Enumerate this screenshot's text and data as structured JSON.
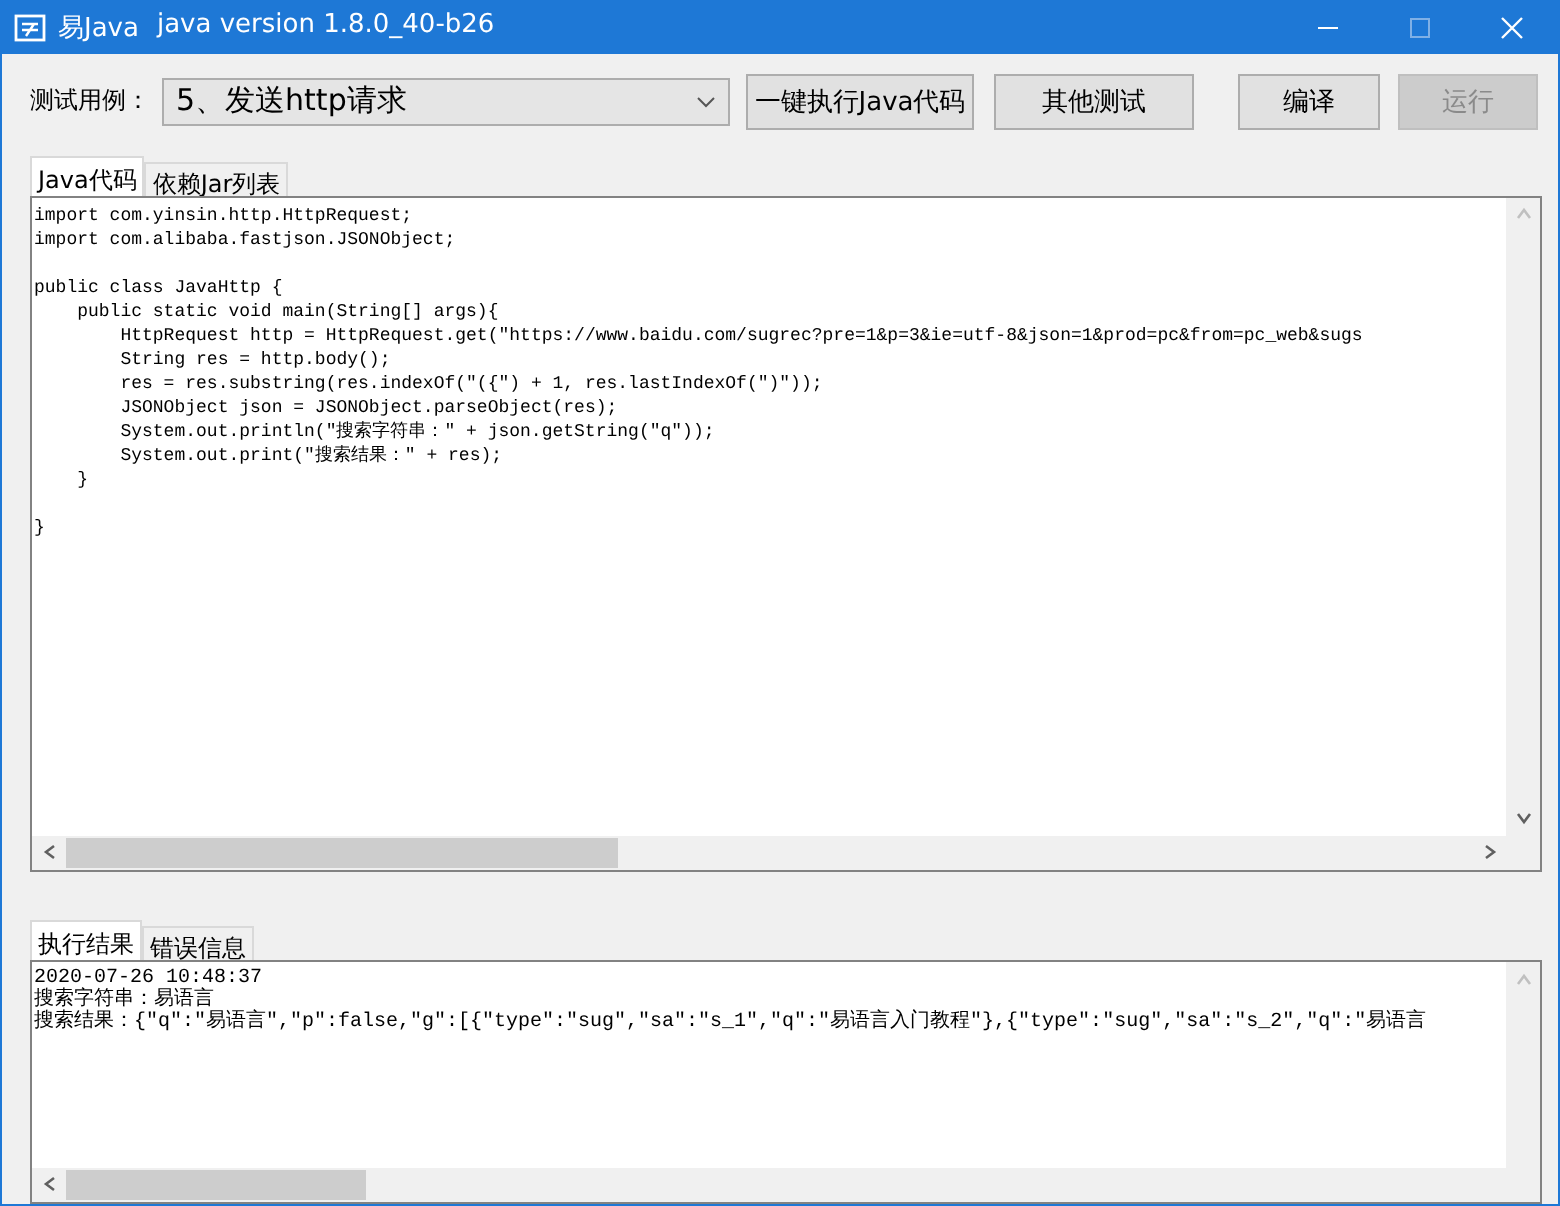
{
  "window": {
    "app_name": "易Java",
    "title": "java version 1.8.0_40-b26"
  },
  "toolbar": {
    "label": "测试用例：",
    "test_case": "5、发送http请求",
    "buttons": [
      {
        "label": "一键执行Java代码",
        "disabled": false
      },
      {
        "label": "其他测试",
        "disabled": false
      },
      {
        "label": "编译",
        "disabled": false
      },
      {
        "label": "运行",
        "disabled": true
      }
    ]
  },
  "code_tabs": [
    {
      "label": "Java代码",
      "selected": true
    },
    {
      "label": "依赖Jar列表",
      "selected": false
    }
  ],
  "code": "import com.yinsin.http.HttpRequest;\nimport com.alibaba.fastjson.JSONObject;\n\npublic class JavaHttp {\n    public static void main(String[] args){\n        HttpRequest http = HttpRequest.get(\"https://www.baidu.com/sugrec?pre=1&p=3&ie=utf-8&json=1&prod=pc&from=pc_web&sugs\n        String res = http.body();\n        res = res.substring(res.indexOf(\"({\") + 1, res.lastIndexOf(\")\"));\n        JSONObject json = JSONObject.parseObject(res);\n        System.out.println(\"搜索字符串：\" + json.getString(\"q\"));\n        System.out.print(\"搜索结果：\" + res);\n    }\n\n}",
  "output_tabs": [
    {
      "label": "执行结果",
      "selected": true
    },
    {
      "label": "错误信息",
      "selected": false
    }
  ],
  "output_lines": [
    "2020-07-26 10:48:37",
    "搜索字符串：易语言",
    "搜索结果：{\"q\":\"易语言\",\"p\":false,\"g\":[{\"type\":\"sug\",\"sa\":\"s_1\",\"q\":\"易语言入门教程\"},{\"type\":\"sug\",\"sa\":\"s_2\",\"q\":\"易语言"
  ]
}
